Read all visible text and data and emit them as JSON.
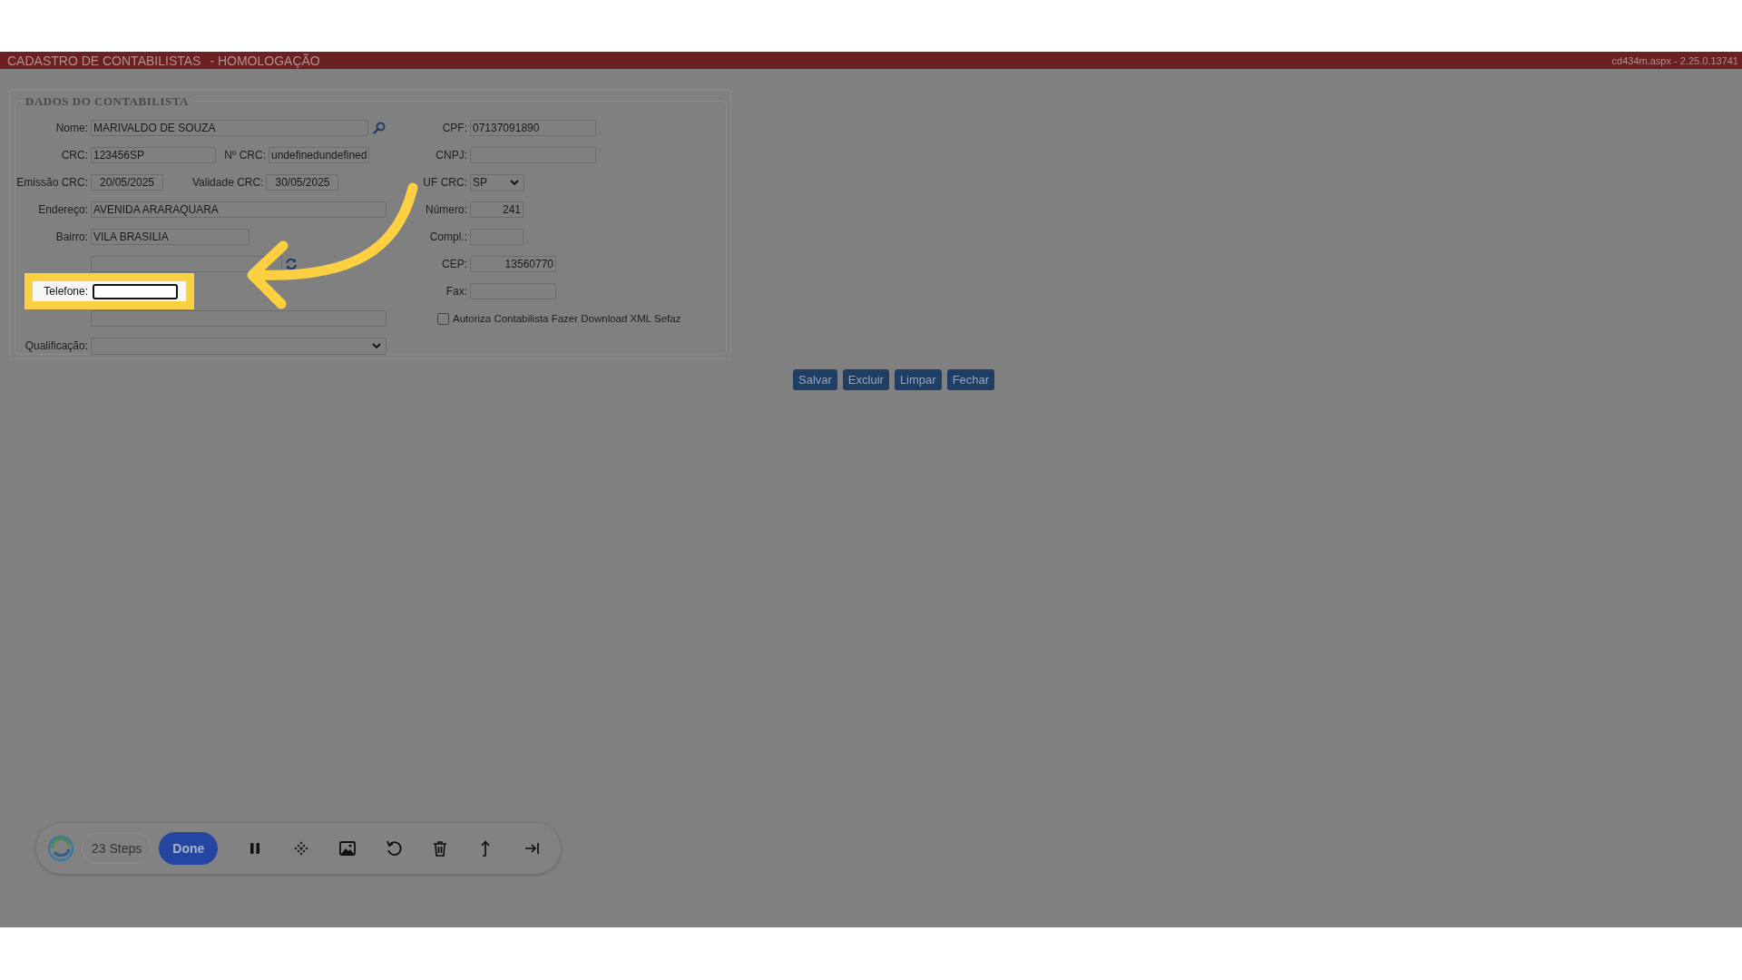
{
  "header": {
    "title": "CADASTRO DE CONTABILISTAS",
    "subtitle": "- HOMOLOGAÇÃO",
    "version": "cd434m.aspx - 2.25.0.13741"
  },
  "fieldset": {
    "legend": "DADOS DO CONTABILISTA",
    "left_rows": [
      [
        {
          "kind": "lookup",
          "label": "Nome:",
          "value": "MARIVALDO DE SOUZA"
        }
      ],
      [
        {
          "kind": "text",
          "label": "CRC:",
          "value": "123456SP"
        },
        {
          "kind": "text",
          "label": "Nº CRC:",
          "value": "undefinedundefined"
        }
      ],
      [
        {
          "kind": "text",
          "label": "Emissão CRC:",
          "value": "20/05/2025"
        },
        {
          "kind": "text",
          "label": "Validade CRC:",
          "value": "30/05/2025"
        }
      ],
      [
        {
          "kind": "text",
          "label": "Endereço:",
          "value": "AVENIDA ARARAQUARA"
        }
      ],
      [
        {
          "kind": "text",
          "label": "Bairro:",
          "value": "VILA BRASILIA"
        }
      ],
      [
        {
          "kind": "reload"
        }
      ],
      [
        {
          "kind": "text",
          "label": "Telefone:",
          "highlighted": true
        }
      ],
      [
        {
          "kind": "text"
        }
      ],
      [
        {
          "kind": "select",
          "label": "Qualificação:"
        }
      ]
    ],
    "right_rows": [
      {
        "kind": "text",
        "label": "CPF:",
        "value": "07137091890"
      },
      {
        "kind": "text",
        "label": "CNPJ:"
      },
      {
        "kind": "select",
        "label": "UF CRC:",
        "value": "SP"
      },
      {
        "kind": "text",
        "label": "Número:",
        "value": "241"
      },
      {
        "kind": "text",
        "label": "Compl.:"
      },
      {
        "kind": "text",
        "label": "CEP:",
        "value": "13560770"
      },
      {
        "kind": "text",
        "label": "Fax:"
      },
      {
        "kind": "checkbox",
        "label": "Autoriza Contabilista Fazer Download XML Sefaz",
        "checked": false
      }
    ]
  },
  "buttons": [
    "Salvar",
    "Excluir",
    "Limpar",
    "Fechar"
  ],
  "recorder": {
    "steps": "23 Steps",
    "done": "Done"
  }
}
